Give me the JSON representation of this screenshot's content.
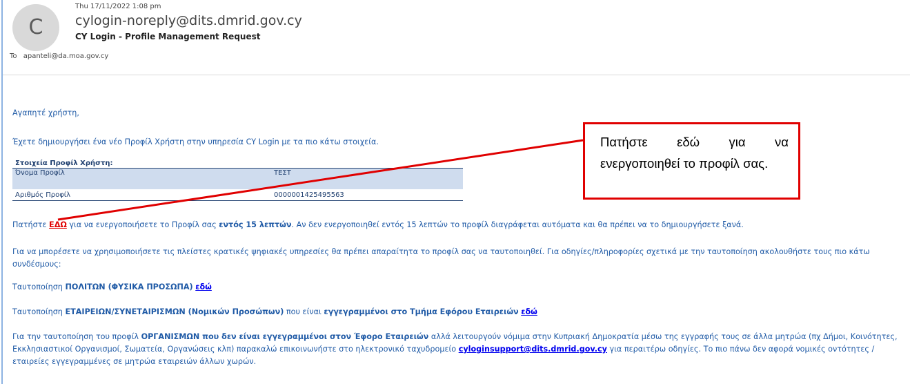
{
  "email": {
    "date": "Thu 17/11/2022 1:08 pm",
    "avatar_letter": "C",
    "sender": "cylogin-noreply@dits.dmrid.gov.cy",
    "subject": "CY Login - Profile Management Request",
    "to_label": "To",
    "to_address": "apanteli@da.moa.gov.cy"
  },
  "body": {
    "greeting": "Αγαπητέ χρήστη,",
    "intro": "Έχετε δημιουργήσει ένα νέο Προφίλ Χρήστη στην υπηρεσία CY Login με τα πιο κάτω στοιχεία.",
    "table": {
      "header": "Στοιχεία Προφίλ Χρήστη:",
      "rows": [
        {
          "label": "Όνομα Προφίλ",
          "value": "ΤΕΣΤ"
        },
        {
          "label": "Αριθμός Προφίλ",
          "value": "0000001425495563"
        }
      ]
    },
    "p1": {
      "a": "Πατήστε ",
      "link": "ΕΔΩ",
      "b": " για να ενεργοποιήσετε το Προφίλ σας ",
      "bold": "εντός 15 λεπτών",
      "c": ". Αν δεν ενεργοποιηθεί εντός 15 λεπτών το προφίλ διαγράφεται αυτόματα και θα πρέπει να το δημιουργήσετε ξανά."
    },
    "p2": "Για να μπορέσετε να χρησιμοποιήσετε τις πλείστες κρατικές ψηφιακές υπηρεσίες θα πρέπει απαραίτητα το προφίλ σας να ταυτοποιηθεί. Για οδηγίες/πληροφορίες σχετικά με την ταυτοποίηση ακολουθήστε τους πιο κάτω συνδέσμους:",
    "p3": {
      "a": "Ταυτοποίηση ",
      "bold": "ΠΟΛΙΤΩΝ (ΦΥΣΙΚΑ ΠΡΟΣΩΠΑ)",
      "link": "εδώ"
    },
    "p4": {
      "a": "Ταυτοποίηση ",
      "bold1": "ΕΤΑΙΡΕΙΩΝ/ΣΥΝΕΤΑΙΡΙΣΜΩΝ (Νομικών Προσώπων)",
      "b": " που είναι ",
      "bold2": "εγγεγραμμένοι στο Τμήμα Εφόρου Εταιρειών",
      "link": "εδώ"
    },
    "p5": {
      "a": "Για την ταυτοποίηση του προφίλ ",
      "bold": "ΟΡΓΑΝΙΣΜΩΝ που δεν είναι εγγεγραμμένοι στον Έφορο Εταιρειών",
      "b": " αλλά λειτουργούν νόμιμα στην Κυπριακή Δημοκρατία μέσω της εγγραφής τους σε άλλα μητρώα (πχ Δήμοι, Κοινότητες, Εκκλησιαστικοί Οργανισμοί, Σωματεία, Οργανώσεις κλπ) παρακαλώ επικοινωνήστε στο ηλεκτρονικό ταχυδρομείο ",
      "link": "cyloginsupport@dits.dmrid.gov.cy",
      "c": " για περαιτέρω οδηγίες. Το πιο πάνω δεν αφορά νομικές οντότητες / εταιρείες εγγεγραμμένες σε μητρώα εταιρειών άλλων χωρών."
    }
  },
  "callout": {
    "text": "Πατήστε εδώ για να ενεργοποιηθεί το προφίλ σας.",
    "color": "#e00000"
  }
}
